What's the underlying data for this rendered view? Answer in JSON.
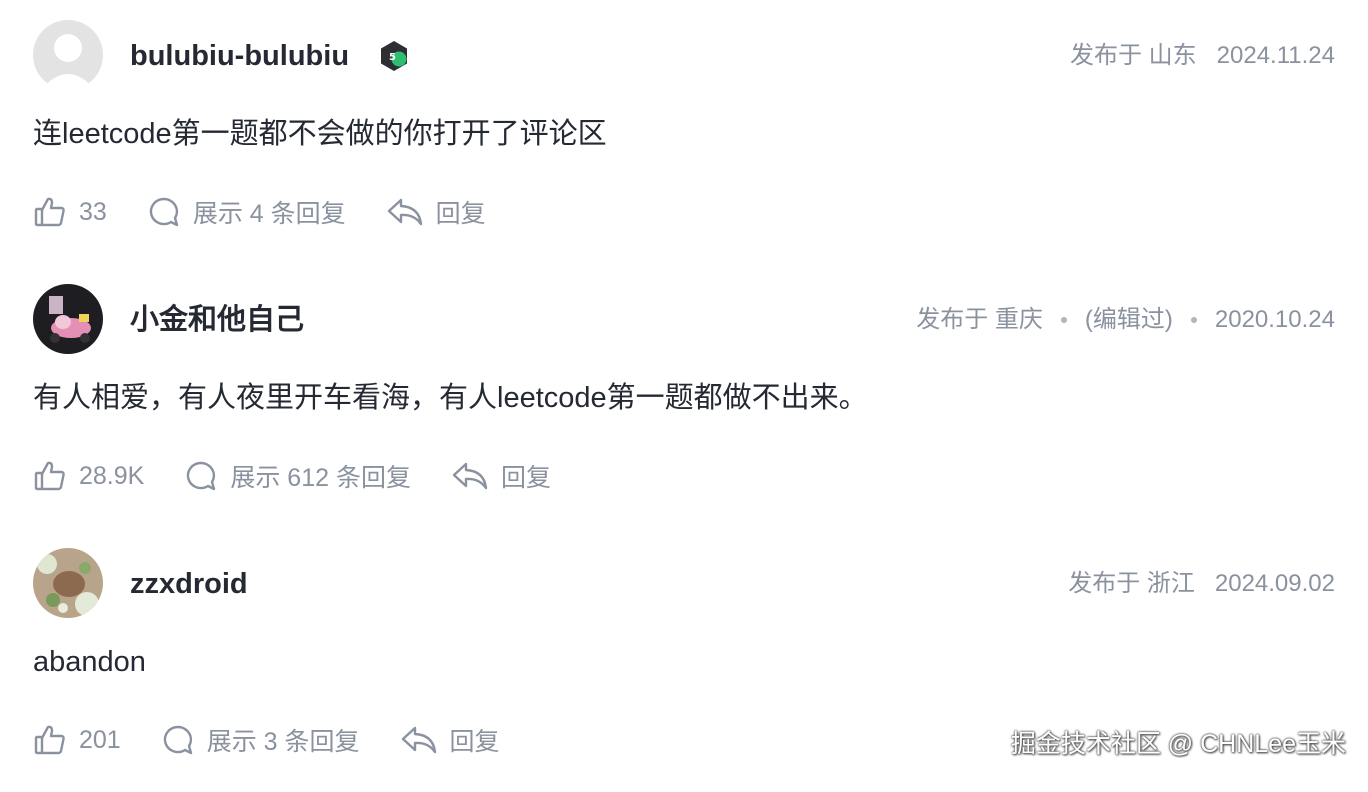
{
  "comments": [
    {
      "username": "bulubiu-bulubiu",
      "location_label": "发布于 山东",
      "edited": "",
      "date": "2024.11.24",
      "content": "连leetcode第一题都不会做的你打开了评论区",
      "likes": "33",
      "replies_label": "展示 4 条回复",
      "reply_label": "回复",
      "badge_icon": "level-badge-icon"
    },
    {
      "username": "小金和他自己",
      "location_label": "发布于 重庆",
      "edited": "(编辑过)",
      "date": "2020.10.24",
      "content": "有人相爱，有人夜里开车看海，有人leetcode第一题都做不出来。",
      "likes": "28.9K",
      "replies_label": "展示 612 条回复",
      "reply_label": "回复"
    },
    {
      "username": "zzxdroid",
      "location_label": "发布于 浙江",
      "edited": "",
      "date": "2024.09.02",
      "content": "abandon",
      "likes": "201",
      "replies_label": "展示 3 条回复",
      "reply_label": "回复"
    }
  ],
  "watermark": "掘金技术社区 @ CHNLee玉米",
  "colors": {
    "text": "#252933",
    "muted": "#8a919f",
    "badge_green": "#2fbf71"
  }
}
